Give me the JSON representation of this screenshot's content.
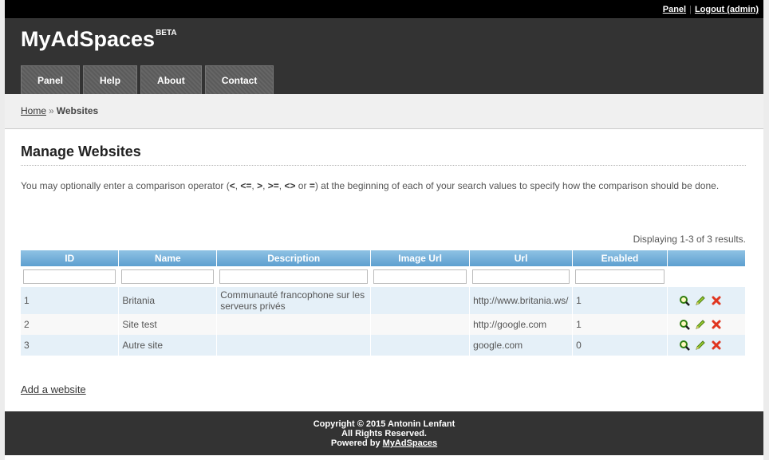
{
  "topbar": {
    "panel_link": "Panel",
    "separator": "|",
    "logout_link": "Logout (admin)"
  },
  "header": {
    "logo": "MyAdSpaces",
    "logo_badge": "BETA"
  },
  "nav": {
    "tabs": [
      {
        "label": "Panel"
      },
      {
        "label": "Help"
      },
      {
        "label": "About"
      },
      {
        "label": "Contact"
      }
    ]
  },
  "breadcrumb": {
    "home": "Home",
    "separator": "»",
    "current": "Websites"
  },
  "main": {
    "title": "Manage Websites",
    "note_pre": "You may optionally enter a comparison operator (",
    "ops": [
      "<",
      "<=",
      ">",
      ">=",
      "<>",
      "="
    ],
    "note_post": " at the beginning of each of your search values to specify how the comparison should be done.",
    "summary": "Displaying 1-3 of 3 results.",
    "add_link": "Add a website"
  },
  "table": {
    "columns": [
      "ID",
      "Name",
      "Description",
      "Image Url",
      "Url",
      "Enabled"
    ],
    "rows": [
      {
        "id": "1",
        "name": "Britania",
        "description": "Communauté francophone sur les serveurs privés",
        "image_url": "",
        "url": "http://www.britania.ws/",
        "enabled": "1"
      },
      {
        "id": "2",
        "name": "Site test",
        "description": "",
        "image_url": "",
        "url": "http://google.com",
        "enabled": "1"
      },
      {
        "id": "3",
        "name": "Autre site",
        "description": "",
        "image_url": "",
        "url": "google.com",
        "enabled": "0"
      }
    ]
  },
  "footer": {
    "line1": "Copyright © 2015 Antonin Lenfant",
    "line2": "All Rights Reserved.",
    "line3_pre": "Powered by ",
    "line3_link": "MyAdSpaces"
  },
  "colors": {
    "header_bg": "#333333",
    "table_header": "#6aabd8",
    "row_odd": "#e5f0f8",
    "row_even": "#f8f8f8"
  },
  "icons": {
    "view": "magnifier-icon",
    "edit": "pencil-icon",
    "delete": "delete-x-icon"
  }
}
